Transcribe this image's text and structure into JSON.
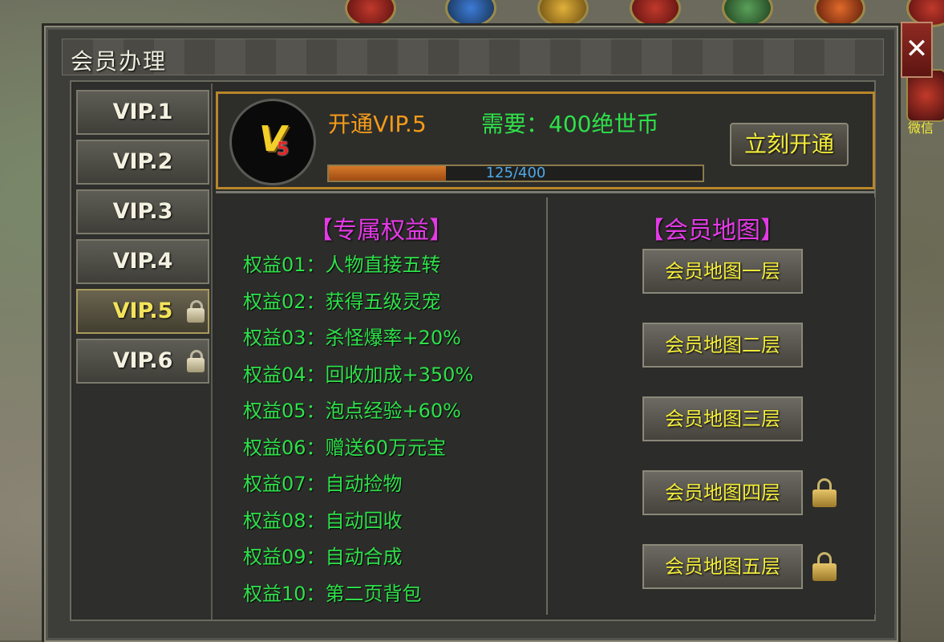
{
  "window": {
    "title": "会员办理",
    "close_glyph": "✕"
  },
  "sidebar": {
    "items": [
      {
        "label": "VIP.1",
        "locked": false,
        "active": false
      },
      {
        "label": "VIP.2",
        "locked": false,
        "active": false
      },
      {
        "label": "VIP.3",
        "locked": false,
        "active": false
      },
      {
        "label": "VIP.4",
        "locked": false,
        "active": false
      },
      {
        "label": "VIP.5",
        "locked": true,
        "active": true
      },
      {
        "label": "VIP.6",
        "locked": true,
        "active": false
      }
    ]
  },
  "header": {
    "badge_main": "V",
    "badge_level": "5",
    "open_label": "开通VIP.5",
    "need_label": "需要：400绝世币",
    "open_button": "立刻开通",
    "progress_text": "125/400",
    "progress_fraction": 0.3125
  },
  "benefits": {
    "title": "【专属权益】",
    "items": [
      "权益01：人物直接五转",
      "权益02：获得五级灵宠",
      "权益03：杀怪爆率+20%",
      "权益04：回收加成+350%",
      "权益05：泡点经验+60%",
      "权益06：赠送60万元宝",
      "权益07：自动捡物",
      "权益08：自动回收",
      "权益09：自动合成",
      "权益10：第二页背包"
    ]
  },
  "maps": {
    "title": "【会员地图】",
    "buttons": [
      {
        "label": "会员地图一层",
        "locked": false
      },
      {
        "label": "会员地图二层",
        "locked": false
      },
      {
        "label": "会员地图三层",
        "locked": false
      },
      {
        "label": "会员地图四层",
        "locked": true
      },
      {
        "label": "会员地图五层",
        "locked": true
      }
    ]
  },
  "side_hud": {
    "label": "微信"
  },
  "colors": {
    "accent_gold": "#b8862a",
    "benefit_green": "#2ee14a",
    "title_magenta": "#e43ae6",
    "open_orange": "#f39b1a"
  }
}
